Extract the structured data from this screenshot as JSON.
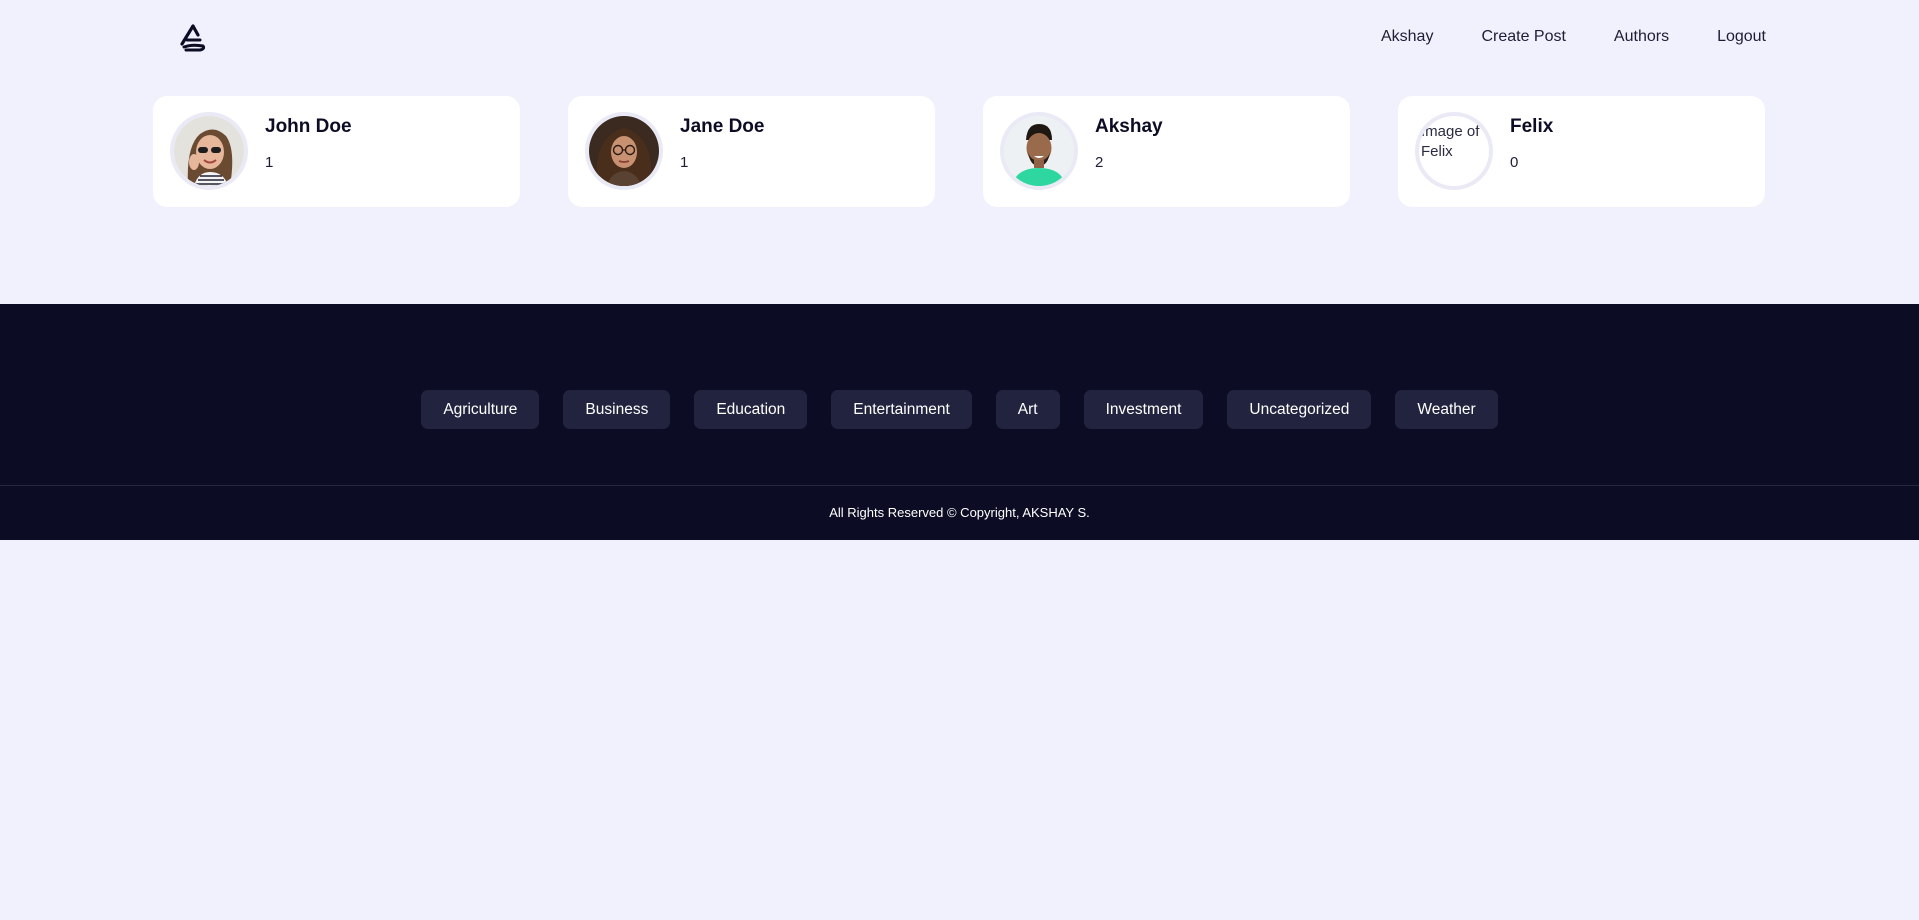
{
  "nav": {
    "logo": "site-logo",
    "links": [
      "Akshay",
      "Create Post",
      "Authors",
      "Logout"
    ]
  },
  "authors": [
    {
      "name": "John Doe",
      "posts": "1",
      "avatar": "avatar-woman-sunglasses"
    },
    {
      "name": "Jane Doe",
      "posts": "1",
      "avatar": "avatar-woman-glasses"
    },
    {
      "name": "Akshay",
      "posts": "2",
      "avatar": "avatar-man-green-shirt"
    },
    {
      "name": "Felix",
      "posts": "0",
      "avatar": "broken-image",
      "avatar_alt": "Image of Felix"
    }
  ],
  "footer": {
    "categories": [
      "Agriculture",
      "Business",
      "Education",
      "Entertainment",
      "Art",
      "Investment",
      "Uncategorized",
      "Weather"
    ],
    "copyright": "All Rights Reserved © Copyright, AKSHAY S."
  },
  "colors": {
    "page_bg": "#f0f1fc",
    "footer_bg": "#0c0d24",
    "category_bg": "#22243f",
    "card_bg": "#ffffff"
  }
}
